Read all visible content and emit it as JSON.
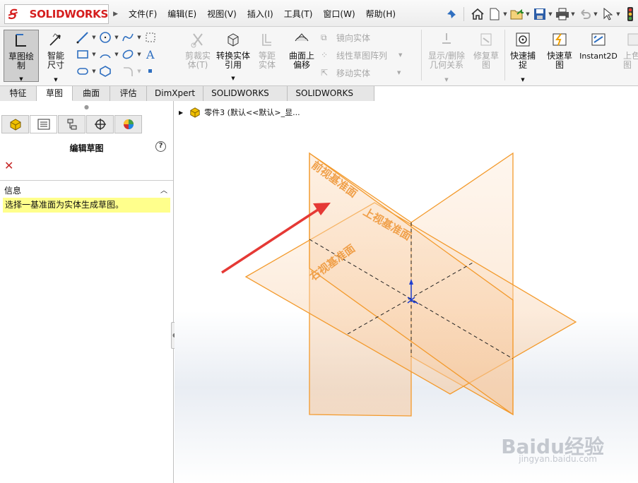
{
  "app": {
    "brand": "SOLIDWORKS"
  },
  "menu": [
    "文件(F)",
    "编辑(E)",
    "视图(V)",
    "插入(I)",
    "工具(T)",
    "窗口(W)",
    "帮助(H)"
  ],
  "quick_toolbar": [
    "home-icon",
    "new-document-icon",
    "open-icon",
    "save-icon",
    "print-icon",
    "undo-icon",
    "select-pointer-icon",
    "traffic-light-icon"
  ],
  "command": {
    "sketch": "草图绘制",
    "smart_dim": "智能尺寸",
    "trim": "剪裁实体(T)",
    "convert": "转换实体引用",
    "offset": "等距实体",
    "surface_offset": "曲面上偏移",
    "mirror": "镜向实体",
    "linear_pattern": "线性草图阵列",
    "move": "移动实体",
    "display_delete": "显示/删除几何关系",
    "repair": "修复草图",
    "quick_snap": "快速捕捉",
    "rapid_sketch": "快速草图",
    "instant2d": "Instant2D",
    "shaded": "上色草图"
  },
  "tabs": [
    "特征",
    "草图",
    "曲面",
    "评估",
    "DimXpert",
    "SOLIDWORKS 插件",
    "SOLIDWORKS MBD"
  ],
  "active_tab": "草图",
  "panel": {
    "title": "编辑草图",
    "section": "信息",
    "message": "选择一基准面为实体生成草图。"
  },
  "tree": {
    "label": "零件3 (默认<<默认>_显..."
  },
  "planes": {
    "front": "前视基准面",
    "top": "上视基准面",
    "right": "右视基准面"
  },
  "watermark": {
    "text": "Baidu经验",
    "url": "jingyan.baidu.com"
  },
  "colors": {
    "plane": "#f39a2c",
    "arrow": "#e53935",
    "brand_red": "#d51e1e"
  }
}
